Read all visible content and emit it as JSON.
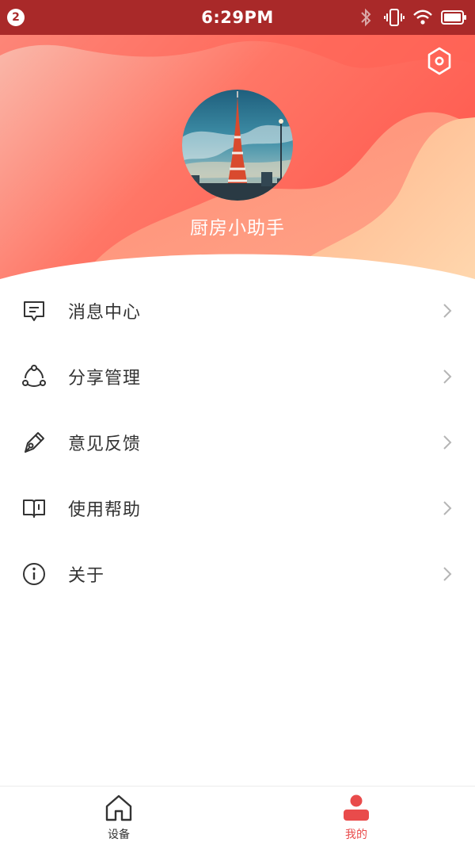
{
  "status_bar": {
    "notification_count": "2",
    "time": "6:29PM",
    "icons": [
      "bluetooth-icon",
      "vibrate-icon",
      "wifi-icon",
      "battery-icon"
    ]
  },
  "profile": {
    "name": "厨房小助手",
    "avatar": "tokyo-tower-photo"
  },
  "menu": [
    {
      "label": "消息中心",
      "icon": "message-icon"
    },
    {
      "label": "分享管理",
      "icon": "share-icon"
    },
    {
      "label": "意见反馈",
      "icon": "feedback-pen-icon"
    },
    {
      "label": "使用帮助",
      "icon": "book-icon"
    },
    {
      "label": "关于",
      "icon": "info-icon"
    }
  ],
  "tabbar": {
    "tabs": [
      {
        "label": "设备",
        "icon": "home-icon",
        "active": false
      },
      {
        "label": "我的",
        "icon": "user-icon",
        "active": true
      }
    ]
  },
  "colors": {
    "accent": "#e94b4b",
    "status_bar": "#a92929",
    "header_gradient_start": "#ff6f61",
    "header_gradient_end": "#ffc79e",
    "text": "#333333",
    "chevron": "#b5b5b5"
  }
}
